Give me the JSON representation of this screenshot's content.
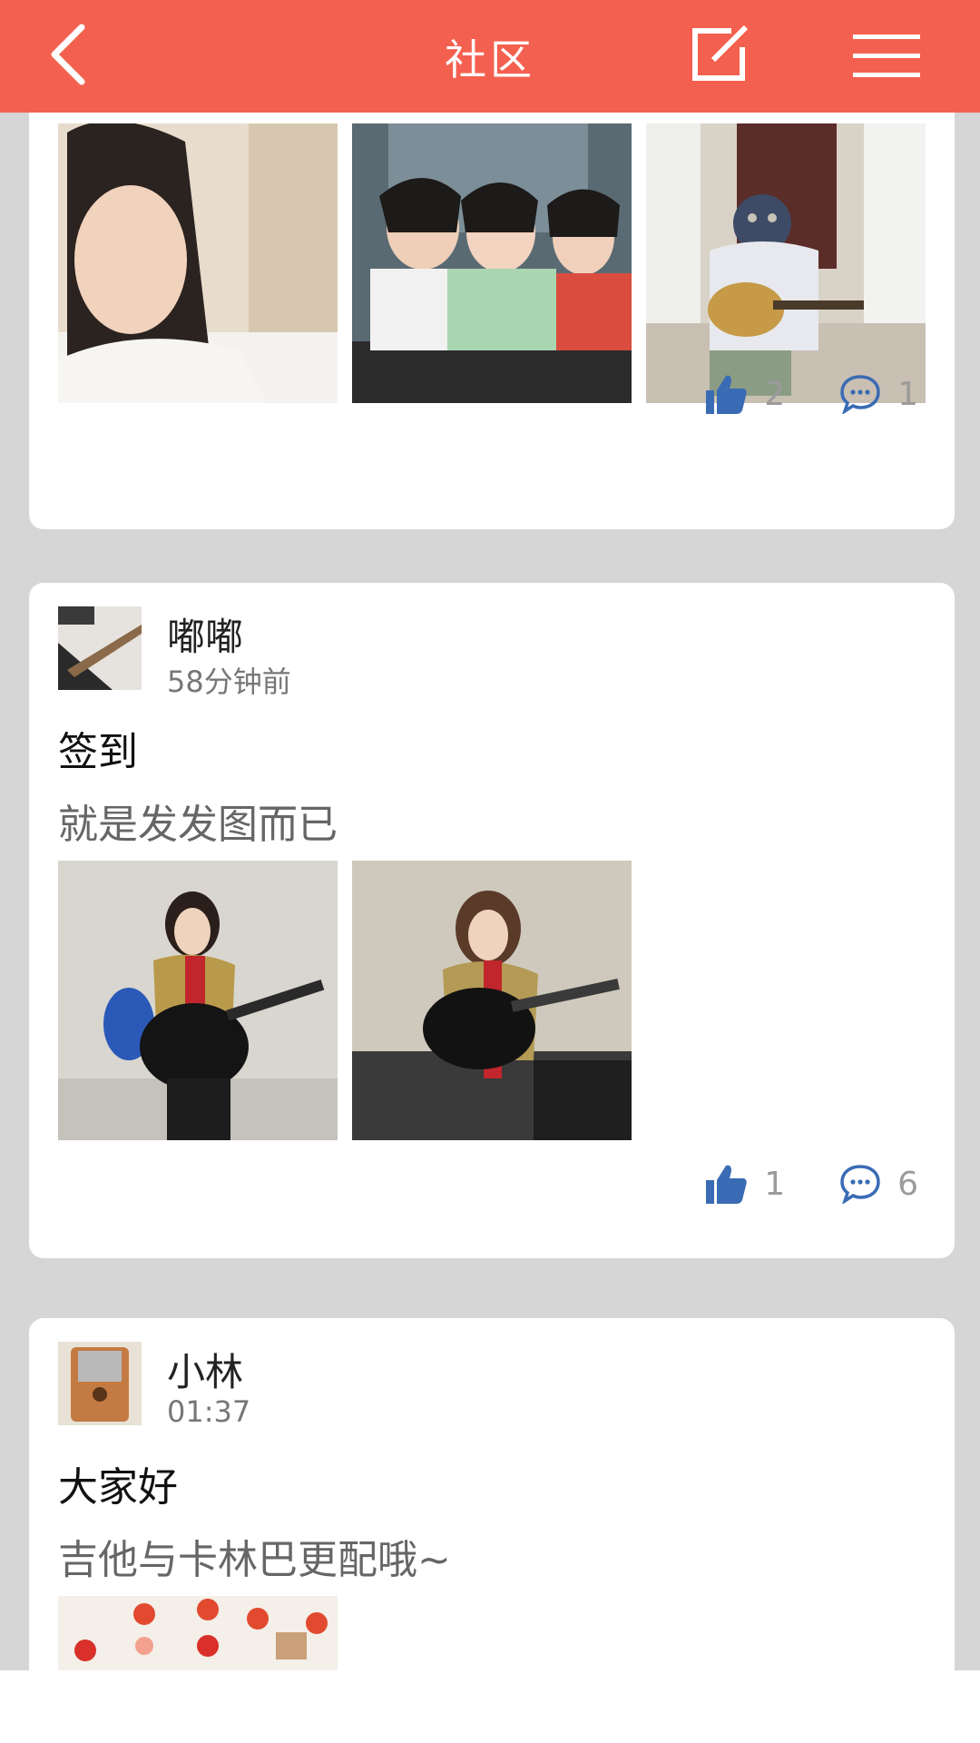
{
  "header": {
    "title": "社区"
  },
  "posts": [
    {
      "likes": "2",
      "comments": "1"
    },
    {
      "username": "嘟嘟",
      "time": "58分钟前",
      "title": "签到",
      "body": "就是发发图而已",
      "likes": "1",
      "comments": "6"
    },
    {
      "username": "小林",
      "time": "01:37",
      "title": "大家好",
      "body": "吉他与卡林巴更配哦~"
    }
  ],
  "icons": {
    "back": "chevron-left-icon",
    "edit": "compose-icon",
    "menu": "hamburger-menu-icon",
    "like": "thumbs-up-icon",
    "comment": "comment-bubble-icon"
  },
  "colors": {
    "header": "#f4604f",
    "icon_blue": "#3a6bb5",
    "background": "#d6d6d6"
  }
}
